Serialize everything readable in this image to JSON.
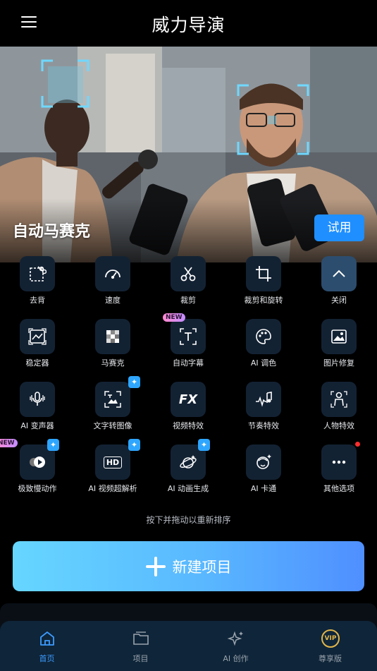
{
  "header": {
    "title": "威力导演",
    "menu_icon": "menu-icon"
  },
  "hero": {
    "label": "自动马赛克",
    "try_label": "试用"
  },
  "tools": [
    {
      "label": "去背",
      "icon": "cutout-icon"
    },
    {
      "label": "速度",
      "icon": "speedometer-icon"
    },
    {
      "label": "裁剪",
      "icon": "scissors-icon"
    },
    {
      "label": "裁剪和旋转",
      "icon": "crop-rotate-icon"
    },
    {
      "label": "关闭",
      "icon": "chevron-up-icon"
    },
    {
      "label": "稳定器",
      "icon": "stabilizer-icon"
    },
    {
      "label": "马赛克",
      "icon": "mosaic-icon"
    },
    {
      "label": "自动字幕",
      "icon": "caption-icon",
      "badge": "NEW"
    },
    {
      "label": "AI 调色",
      "icon": "palette-icon"
    },
    {
      "label": "图片修复",
      "icon": "photo-repair-icon"
    },
    {
      "label": "AI 变声器",
      "icon": "voice-changer-icon"
    },
    {
      "label": "文字转图像",
      "icon": "text-to-image-icon"
    },
    {
      "label": "视频特效",
      "icon": "fx-icon",
      "fx_text": "FX"
    },
    {
      "label": "节奏特效",
      "icon": "beat-effect-icon"
    },
    {
      "label": "人物特效",
      "icon": "person-effect-icon"
    },
    {
      "label": "极致慢动作",
      "icon": "slow-motion-icon",
      "badge": "NEW"
    },
    {
      "label": "AI 视频超解析",
      "icon": "hd-upscale-icon",
      "hd_text": "HD"
    },
    {
      "label": "AI 动画生成",
      "icon": "animation-icon"
    },
    {
      "label": "AI 卡通",
      "icon": "cartoon-icon"
    },
    {
      "label": "其他选项",
      "icon": "more-icon"
    }
  ],
  "hint": "按下并拖动以重新排序",
  "new_project_label": "新建项目",
  "nav": [
    {
      "label": "首页",
      "icon": "home-icon",
      "active": true
    },
    {
      "label": "项目",
      "icon": "folder-icon"
    },
    {
      "label": "AI 创作",
      "icon": "sparkle-icon"
    },
    {
      "label": "尊享版",
      "icon": "vip-icon",
      "vip_text": "VIP"
    }
  ],
  "colors": {
    "accent": "#1f8fff",
    "nav_bg": "#0f2539",
    "tile_bg": "#132233",
    "active_nav": "#3c9bff"
  }
}
